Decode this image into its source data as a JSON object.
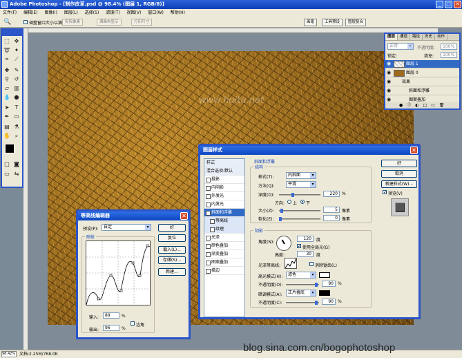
{
  "app": {
    "title": "Adobe Photoshop - [制作皮革.psd @ 98.4% (图层 1, RGB/8)]",
    "window_min": "_",
    "window_max": "□",
    "window_close": "✕"
  },
  "menu": [
    "文件(F)",
    "编辑(E)",
    "图像(I)",
    "图层(L)",
    "选择(S)",
    "滤镜(T)",
    "视图(V)",
    "窗口(W)",
    "帮助(H)"
  ],
  "options": {
    "resize_window": "调整窗口大小以满屏显示",
    "btn_actual": "实际像素",
    "btn_fit": "满画布显示",
    "btn_print": "打印尺寸",
    "tabs": [
      "画笔",
      "工具预设",
      "图层复合"
    ]
  },
  "watermark": "www.huitu.net",
  "credit": "blog.sina.com.cn/bogophotoshop",
  "status": {
    "zoom": "98.42%",
    "doc": "文档:2.25M/768.0K"
  },
  "layers": {
    "tabs": [
      "图层",
      "通道",
      "路径",
      "历史",
      "动作"
    ],
    "blend": "正常",
    "opacity_label": "不透明度:",
    "opacity": "100%",
    "lock_label": "锁定:",
    "fill_label": "填充:",
    "fill": "100%",
    "rows": [
      {
        "name": "图层 1",
        "selected": true
      },
      {
        "name": "图层 0",
        "selected": false
      },
      {
        "name": "效果",
        "selected": false
      },
      {
        "name": "斜面和浮雕",
        "selected": false
      },
      {
        "name": "图案叠加",
        "selected": false
      }
    ]
  },
  "layer_style": {
    "title": "图层样式",
    "list": [
      "样式",
      "混合选项:默认",
      "投影",
      "内阴影",
      "外发光",
      "内发光",
      "斜面和浮雕",
      "等高线",
      "纹理",
      "光泽",
      "颜色叠加",
      "渐变叠加",
      "图案叠加",
      "描边"
    ],
    "section_title": "斜面和浮雕",
    "structure": "结构",
    "style_label": "样式(T):",
    "style_val": "内斜面",
    "method_label": "方法(Q):",
    "method_val": "平滑",
    "depth_label": "深度(D):",
    "depth_val": "220",
    "depth_unit": "%",
    "dir_label": "方向:",
    "dir_up": "上",
    "dir_down": "下",
    "size_label": "大小(Z):",
    "size_val": "5",
    "soften_label": "软化(E):",
    "soften_val": "0",
    "px": "像素",
    "shading": "阴影",
    "angle_label": "角度(N):",
    "angle_val": "120",
    "deg": "度",
    "global_light": "使用全局光(G)",
    "altitude_label": "高度:",
    "altitude_val": "30",
    "gloss_label": "光泽等高线:",
    "antialias": "消除锯齿(L)",
    "hl_mode_label": "高光模式(H):",
    "hl_mode": "滤色",
    "hl_opacity_label": "不透明度(O):",
    "hl_opacity": "90",
    "sh_mode_label": "暗调模式(A):",
    "sh_mode": "正片叠底",
    "sh_opacity_label": "不透明度(C):",
    "sh_opacity": "90",
    "pct": "%",
    "ok": "好",
    "cancel": "取消",
    "new_style": "新建样式(W)...",
    "preview": "预览(V)"
  },
  "contour": {
    "title": "等高线编辑器",
    "preset_label": "预设(P):",
    "preset_val": "自定",
    "ok": "好",
    "reset": "复位",
    "load": "载入(L)...",
    "save": "存储(S)...",
    "new": "新建...",
    "mapping": "映射",
    "input_label": "输入:",
    "input_val": "89",
    "output_label": "输出:",
    "output_val": "96",
    "pct": "%",
    "corner": "边角"
  }
}
